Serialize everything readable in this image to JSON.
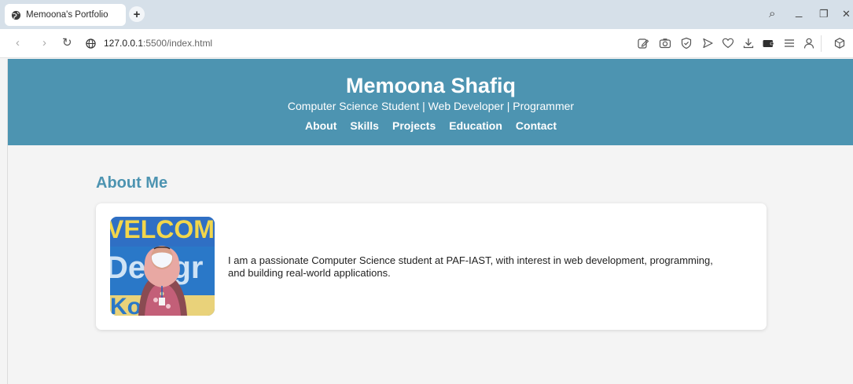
{
  "browser": {
    "tab_title": "Memoona's Portfolio",
    "new_tab_symbol": "+",
    "url_host": "127.0.0.1",
    "url_rest": ":5500/index.html",
    "search_symbol": "⌕",
    "minimize_symbol": "_",
    "restore_symbol": "❐",
    "close_symbol": "✕",
    "back_symbol": "‹",
    "forward_symbol": "›",
    "reload_symbol": "↻"
  },
  "header": {
    "name": "Memoona Shafiq",
    "tagline": "Computer Science Student | Web Developer | Programmer",
    "nav": [
      "About",
      "Skills",
      "Projects",
      "Education",
      "Contact"
    ]
  },
  "about": {
    "title": "About Me",
    "text": "I am a passionate Computer Science student at PAF-IAST, with interest in web development, programming, and building real-world applications.",
    "photo_banner_text": "WELCOME Design"
  },
  "colors": {
    "accent": "#4d94b1",
    "page_bg": "#f4f4f4",
    "tab_strip": "#d6e0e9"
  }
}
